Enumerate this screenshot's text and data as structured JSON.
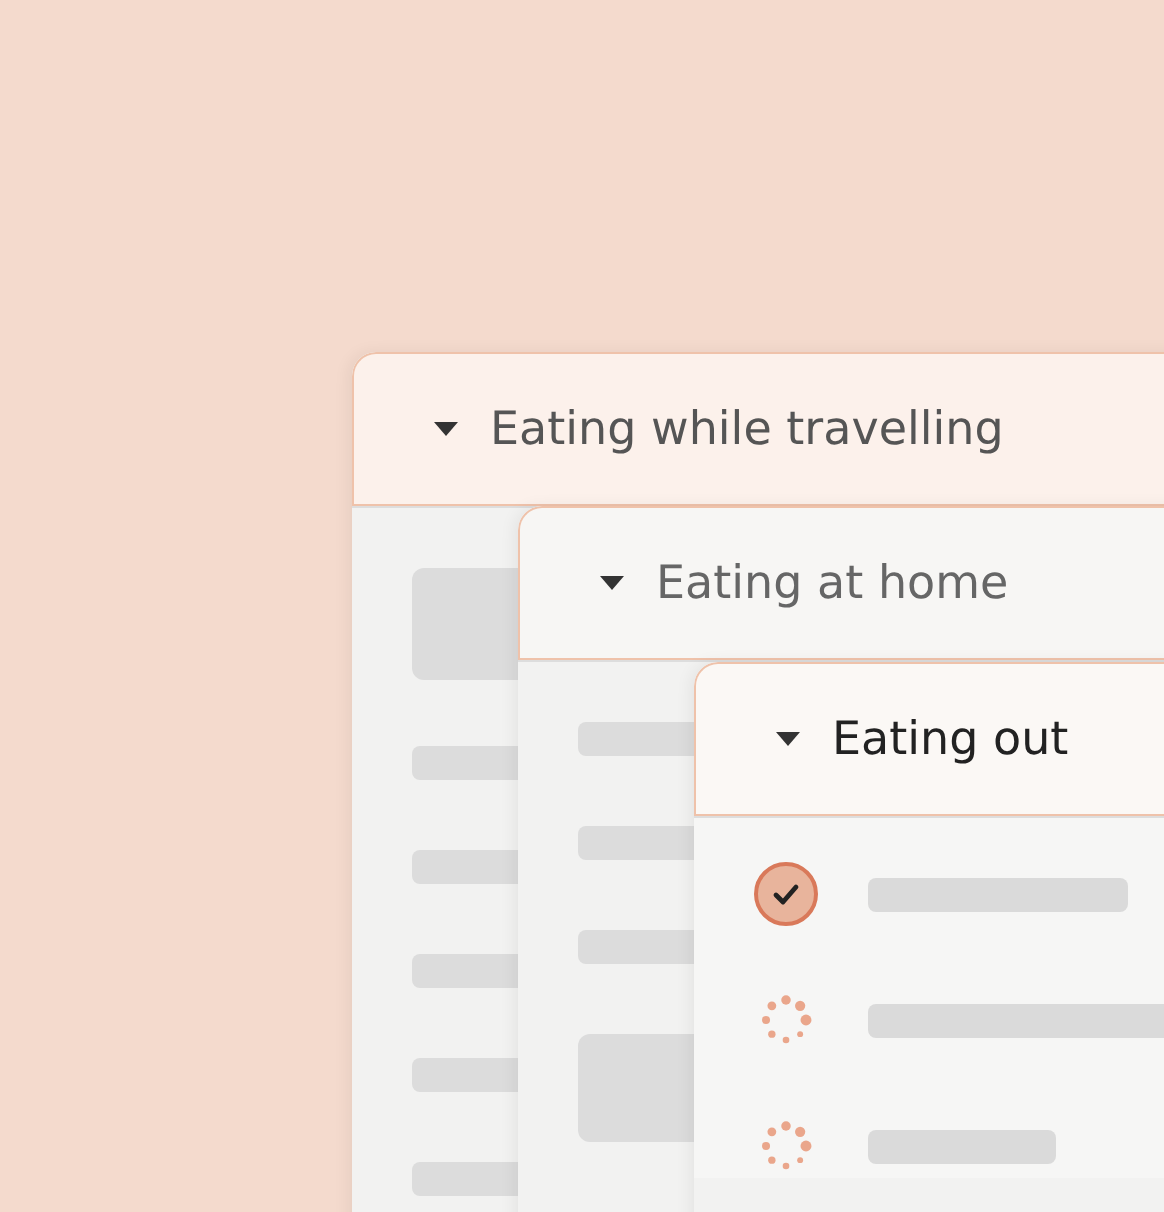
{
  "cards": [
    {
      "title": "Eating while travelling",
      "expanded": true
    },
    {
      "title": "Eating at home",
      "expanded": true
    },
    {
      "title": "Eating out",
      "expanded": true,
      "items": [
        {
          "kind": "done"
        },
        {
          "kind": "loading"
        },
        {
          "kind": "loading"
        }
      ]
    }
  ]
}
